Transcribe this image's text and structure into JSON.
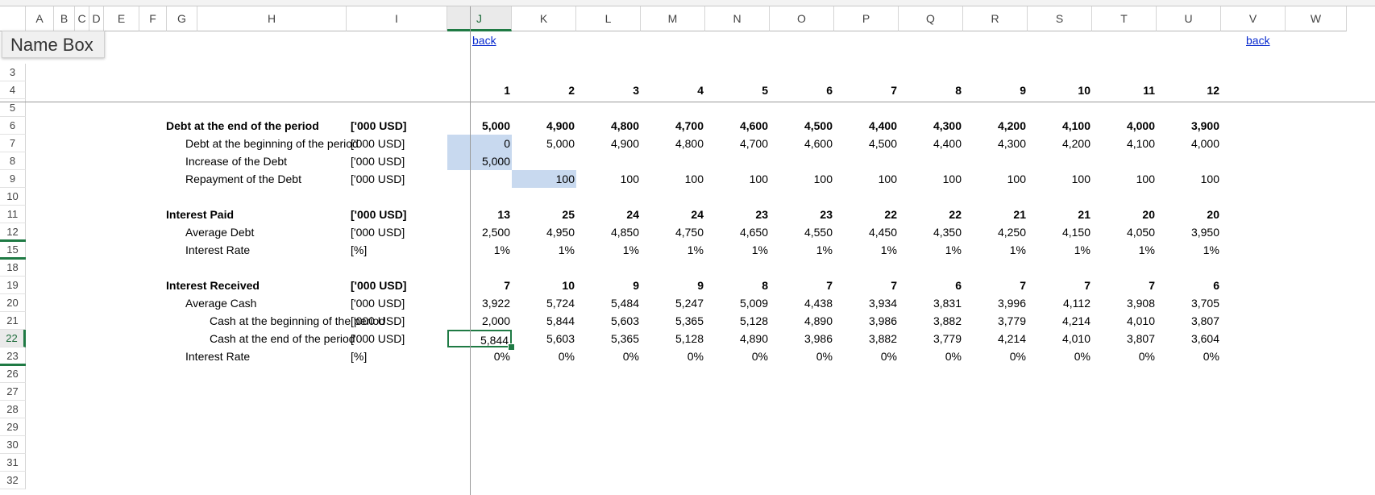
{
  "name_box": {
    "label": "Name Box"
  },
  "columns": [
    "A",
    "B",
    "C",
    "D",
    "E",
    "F",
    "G",
    "H",
    "I",
    "J",
    "K",
    "L",
    "M",
    "N",
    "O",
    "P",
    "Q",
    "R",
    "S",
    "T",
    "U",
    "V",
    "W"
  ],
  "selected_column": "J",
  "rows": [
    "3",
    "4",
    "5",
    "6",
    "7",
    "8",
    "9",
    "10",
    "11",
    "12",
    "15",
    "18",
    "19",
    "20",
    "21",
    "22",
    "23",
    "26",
    "27",
    "28",
    "29",
    "30",
    "31",
    "32"
  ],
  "selected_row": "22",
  "links": {
    "back_left": "back",
    "back_right": "back"
  },
  "periods": [
    "1",
    "2",
    "3",
    "4",
    "5",
    "6",
    "7",
    "8",
    "9",
    "10",
    "11",
    "12"
  ],
  "table_rows": [
    {
      "label": "Debt at the end of the period",
      "unit": "['000 USD]",
      "bold": true,
      "indent": 0,
      "values": [
        "5,000",
        "4,900",
        "4,800",
        "4,700",
        "4,600",
        "4,500",
        "4,400",
        "4,300",
        "4,200",
        "4,100",
        "4,000",
        "3,900"
      ]
    },
    {
      "label": "Debt at the beginning of the period",
      "unit": "['000 USD]",
      "bold": false,
      "indent": 1,
      "values": [
        "0",
        "5,000",
        "4,900",
        "4,800",
        "4,700",
        "4,600",
        "4,500",
        "4,400",
        "4,300",
        "4,200",
        "4,100",
        "4,000"
      ]
    },
    {
      "label": "Increase of the Debt",
      "unit": "['000 USD]",
      "bold": false,
      "indent": 1,
      "values": [
        "5,000",
        "",
        "",
        "",
        "",
        "",
        "",
        "",
        "",
        "",
        "",
        ""
      ]
    },
    {
      "label": "Repayment of the Debt",
      "unit": "['000 USD]",
      "bold": false,
      "indent": 1,
      "values": [
        "",
        "100",
        "100",
        "100",
        "100",
        "100",
        "100",
        "100",
        "100",
        "100",
        "100",
        "100"
      ]
    },
    {
      "label": "",
      "unit": "",
      "bold": false,
      "indent": 0,
      "values": []
    },
    {
      "label": "Interest Paid",
      "unit": "['000 USD]",
      "bold": true,
      "indent": 0,
      "values": [
        "13",
        "25",
        "24",
        "24",
        "23",
        "23",
        "22",
        "22",
        "21",
        "21",
        "20",
        "20"
      ]
    },
    {
      "label": "Average Debt",
      "unit": "['000 USD]",
      "bold": false,
      "indent": 1,
      "values": [
        "2,500",
        "4,950",
        "4,850",
        "4,750",
        "4,650",
        "4,550",
        "4,450",
        "4,350",
        "4,250",
        "4,150",
        "4,050",
        "3,950"
      ]
    },
    {
      "label": "Interest Rate",
      "unit": "[%]",
      "bold": false,
      "indent": 1,
      "values": [
        "1%",
        "1%",
        "1%",
        "1%",
        "1%",
        "1%",
        "1%",
        "1%",
        "1%",
        "1%",
        "1%",
        "1%"
      ]
    },
    {
      "label": "",
      "unit": "",
      "bold": false,
      "indent": 0,
      "values": []
    },
    {
      "label": "Interest Received",
      "unit": "['000 USD]",
      "bold": true,
      "indent": 0,
      "values": [
        "7",
        "10",
        "9",
        "9",
        "8",
        "7",
        "7",
        "6",
        "7",
        "7",
        "7",
        "6"
      ]
    },
    {
      "label": "Average Cash",
      "unit": "['000 USD]",
      "bold": false,
      "indent": 1,
      "values": [
        "3,922",
        "5,724",
        "5,484",
        "5,247",
        "5,009",
        "4,438",
        "3,934",
        "3,831",
        "3,996",
        "4,112",
        "3,908",
        "3,705"
      ]
    },
    {
      "label": "Cash at the beginning of the period",
      "unit": "['000 USD]",
      "bold": false,
      "indent": 2,
      "values": [
        "2,000",
        "5,844",
        "5,603",
        "5,365",
        "5,128",
        "4,890",
        "3,986",
        "3,882",
        "3,779",
        "4,214",
        "4,010",
        "3,807"
      ]
    },
    {
      "label": "Cash at the end of the period",
      "unit": "['000 USD]",
      "bold": false,
      "indent": 2,
      "values": [
        "5,844",
        "5,603",
        "5,365",
        "5,128",
        "4,890",
        "3,986",
        "3,882",
        "3,779",
        "4,214",
        "4,010",
        "3,807",
        "3,604"
      ]
    },
    {
      "label": "Interest Rate",
      "unit": "[%]",
      "bold": false,
      "indent": 1,
      "values": [
        "0%",
        "0%",
        "0%",
        "0%",
        "0%",
        "0%",
        "0%",
        "0%",
        "0%",
        "0%",
        "0%",
        "0%"
      ]
    }
  ],
  "colors": {
    "selection_fill": "#c8d9ef",
    "accent_green": "#1f7a44",
    "link_blue": "#0b2ccf"
  }
}
